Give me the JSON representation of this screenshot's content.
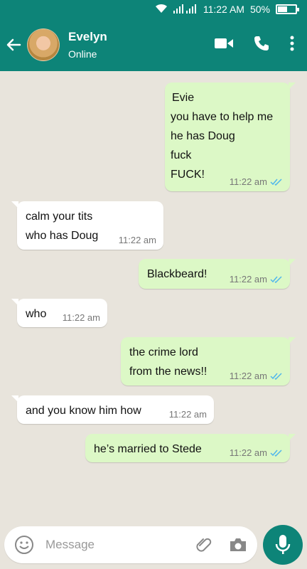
{
  "status": {
    "time": "11:22 AM",
    "battery": "50%"
  },
  "header": {
    "name": "Evelyn",
    "presence": "Online"
  },
  "messages": [
    {
      "lines": [
        "Evie",
        "you have to help me",
        "he has Doug",
        "fuck",
        "FUCK!"
      ],
      "time": "11:22 am"
    },
    {
      "lines": [
        "calm your tits",
        "who has Doug"
      ],
      "time": "11:22 am"
    },
    {
      "lines": [
        "Blackbeard!"
      ],
      "time": "11:22 am"
    },
    {
      "lines": [
        "who"
      ],
      "time": "11:22 am"
    },
    {
      "lines": [
        "the crime lord",
        "from the news!!"
      ],
      "time": "11:22 am"
    },
    {
      "lines": [
        "and you know him how"
      ],
      "time": "11:22 am"
    },
    {
      "lines": [
        "he’s married to Stede"
      ],
      "time": "11:22 am"
    }
  ],
  "composer": {
    "placeholder": "Message"
  },
  "colors": {
    "header": "#0d8478",
    "outgoing": "#dcf8c6",
    "incoming": "#ffffff",
    "ticks": "#4fb6ec"
  }
}
